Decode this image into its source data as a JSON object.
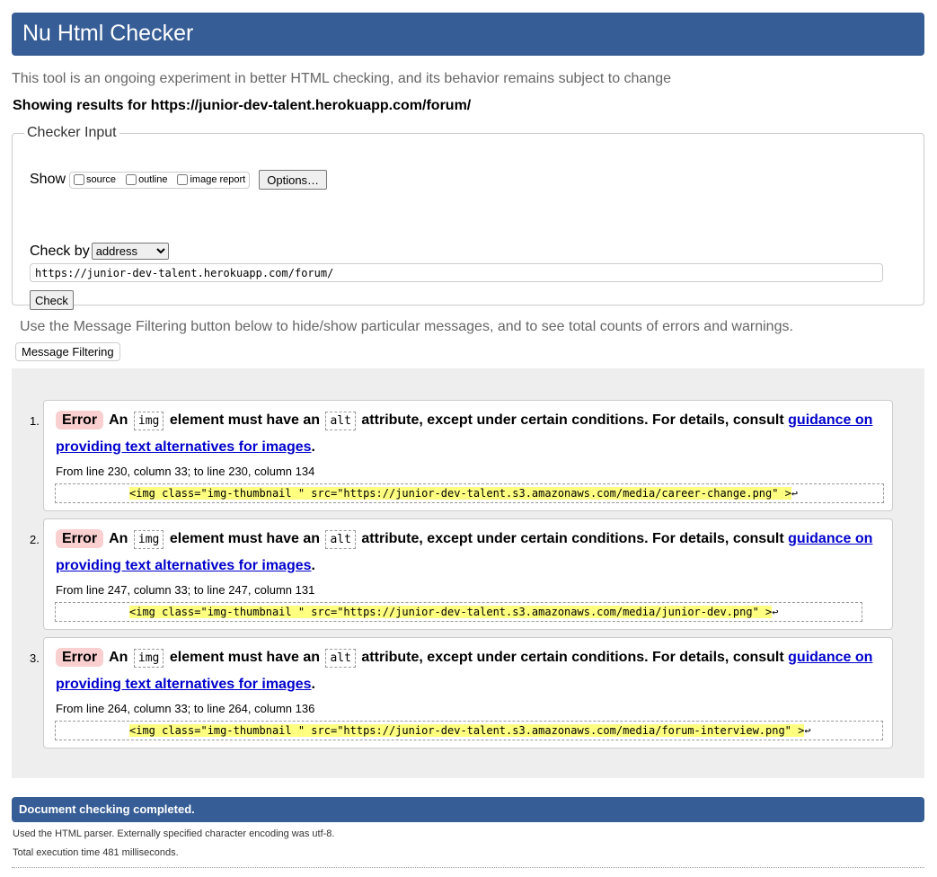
{
  "header": {
    "title": "Nu Html Checker"
  },
  "subtitle": "This tool is an ongoing experiment in better HTML checking, and its behavior remains subject to change",
  "results_for": "Showing results for https://junior-dev-talent.herokuapp.com/forum/",
  "checker_input": {
    "legend": "Checker Input",
    "show_label": "Show",
    "show_options": [
      {
        "label": "source",
        "checked": false
      },
      {
        "label": "outline",
        "checked": false
      },
      {
        "label": "image report",
        "checked": false
      }
    ],
    "options_button": "Options…",
    "check_by_label": "Check by",
    "check_by_selected": "address",
    "url_value": "https://junior-dev-talent.herokuapp.com/forum/",
    "check_button": "Check"
  },
  "filter": {
    "note": "Use the Message Filtering button below to hide/show particular messages, and to see total counts of errors and warnings.",
    "button": "Message Filtering"
  },
  "messages": [
    {
      "num": "1.",
      "type": "Error",
      "pre": "An",
      "code1": "img",
      "mid": "element must have an",
      "code2": "alt",
      "post": "attribute, except under certain conditions. For details, consult",
      "link": "guidance on providing text alternatives for images",
      "end": ".",
      "location": "From line 230, column 33; to line 230, column 134",
      "extract": "<img class=\"img-thumbnail \" src=\"https://junior-dev-talent.s3.amazonaws.com/media/career-change.png\" >",
      "ret": "↩"
    },
    {
      "num": "2.",
      "type": "Error",
      "pre": "An",
      "code1": "img",
      "mid": "element must have an",
      "code2": "alt",
      "post": "attribute, except under certain conditions. For details, consult",
      "link": "guidance on providing text alternatives for images",
      "end": ".",
      "location": "From line 247, column 33; to line 247, column 131",
      "extract": "<img class=\"img-thumbnail \" src=\"https://junior-dev-talent.s3.amazonaws.com/media/junior-dev.png\" >",
      "ret": "↩"
    },
    {
      "num": "3.",
      "type": "Error",
      "pre": "An",
      "code1": "img",
      "mid": "element must have an",
      "code2": "alt",
      "post": "attribute, except under certain conditions. For details, consult",
      "link": "guidance on providing text alternatives for images",
      "end": ".",
      "location": "From line 264, column 33; to line 264, column 136",
      "extract": "<img class=\"img-thumbnail \" src=\"https://junior-dev-talent.s3.amazonaws.com/media/forum-interview.png\" >",
      "ret": "↩"
    }
  ],
  "status": {
    "title": "Document checking completed.",
    "parser_note": "Used the HTML parser. Externally specified character encoding was utf-8.",
    "exec_time": "Total execution time 481 milliseconds."
  }
}
